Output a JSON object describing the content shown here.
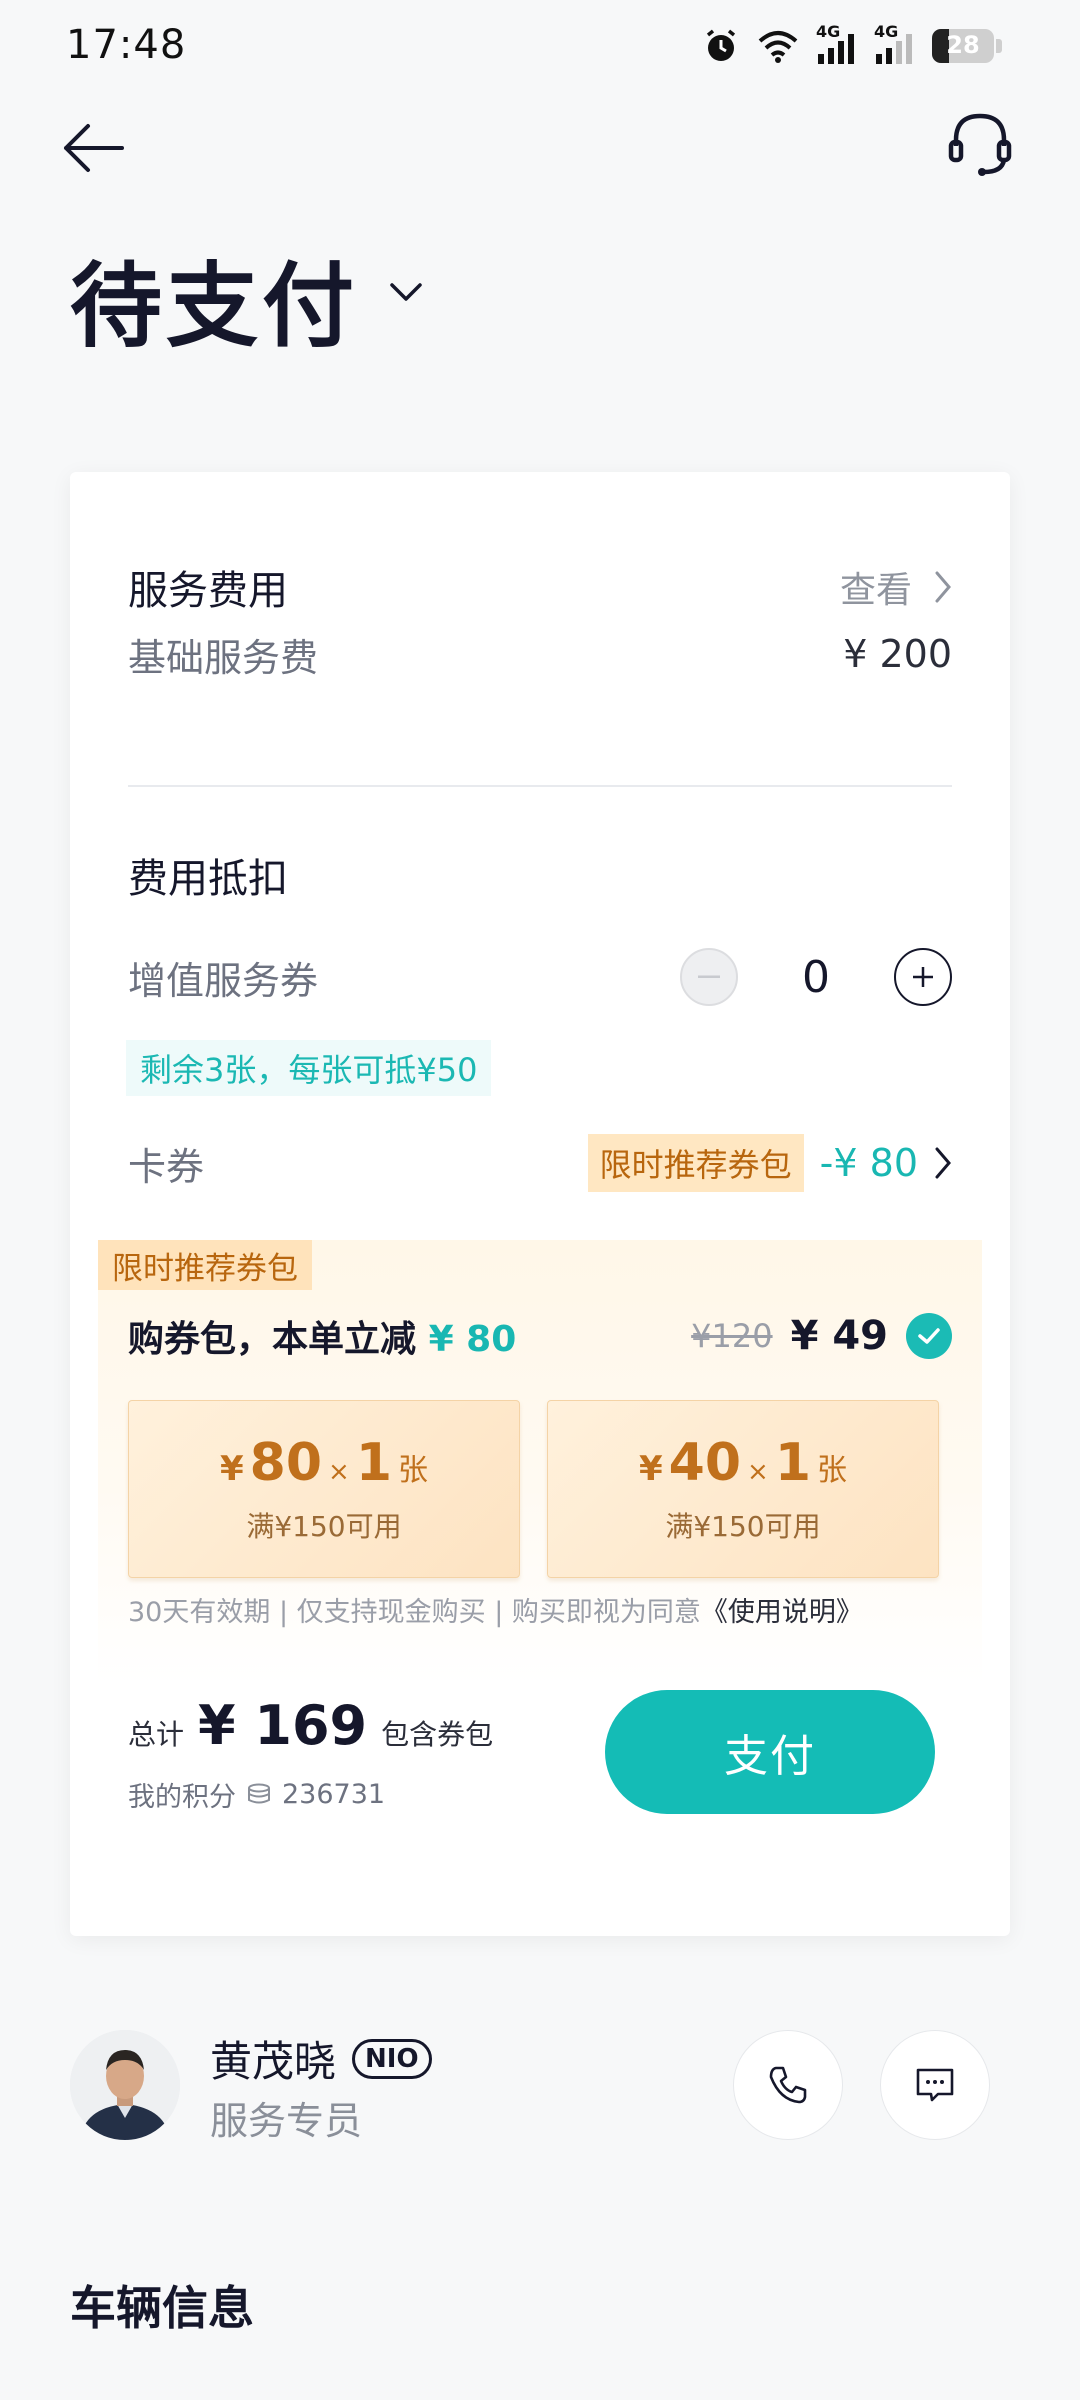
{
  "status_bar": {
    "time": "17:48",
    "network_1": "4G",
    "network_2": "4G",
    "battery_level": "28"
  },
  "header": {
    "back_icon": "arrow-left-icon",
    "support_icon": "headset-icon",
    "title": "待支付",
    "title_chevron_icon": "chevron-down-icon"
  },
  "fees": {
    "title": "服务费用",
    "view_label": "查看",
    "base_label": "基础服务费",
    "base_value": "¥ 200"
  },
  "deduction": {
    "title": "费用抵扣",
    "voucher_label": "增值服务券",
    "voucher_count": "0",
    "voucher_tip": "剩余3张，每张可抵¥50",
    "coupon_label": "卡券",
    "coupon_tag": "限时推荐券包",
    "coupon_discount": "-¥ 80"
  },
  "pack": {
    "tag": "限时推荐券包",
    "title_prefix": "购券包，本单立减",
    "title_amount": "¥ 80",
    "old_price": "¥120",
    "new_price": "¥ 49",
    "selected": true,
    "coupons": [
      {
        "yen": "¥",
        "amount": "80",
        "times": "×",
        "qty": "1",
        "unit": "张",
        "condition": "满¥150可用"
      },
      {
        "yen": "¥",
        "amount": "40",
        "times": "×",
        "qty": "1",
        "unit": "张",
        "condition": "满¥150可用"
      }
    ],
    "terms": "30天有效期 | 仅支持现金购买 | 购买即视为同意",
    "terms_link": "《使用说明》"
  },
  "summary": {
    "total_label": "总计",
    "total_amount": "¥ 169",
    "total_note": "包含券包",
    "points_label": "我的积分",
    "points_value": "236731",
    "pay_label": "支付"
  },
  "specialist": {
    "name": "黄茂晓",
    "badge": "NIO",
    "role": "服务专员",
    "phone_icon": "phone-icon",
    "message_icon": "message-icon"
  },
  "vehicle": {
    "title": "车辆信息"
  },
  "colors": {
    "accent": "#14bcb6",
    "promo": "#b8660e",
    "text": "#15172b"
  }
}
